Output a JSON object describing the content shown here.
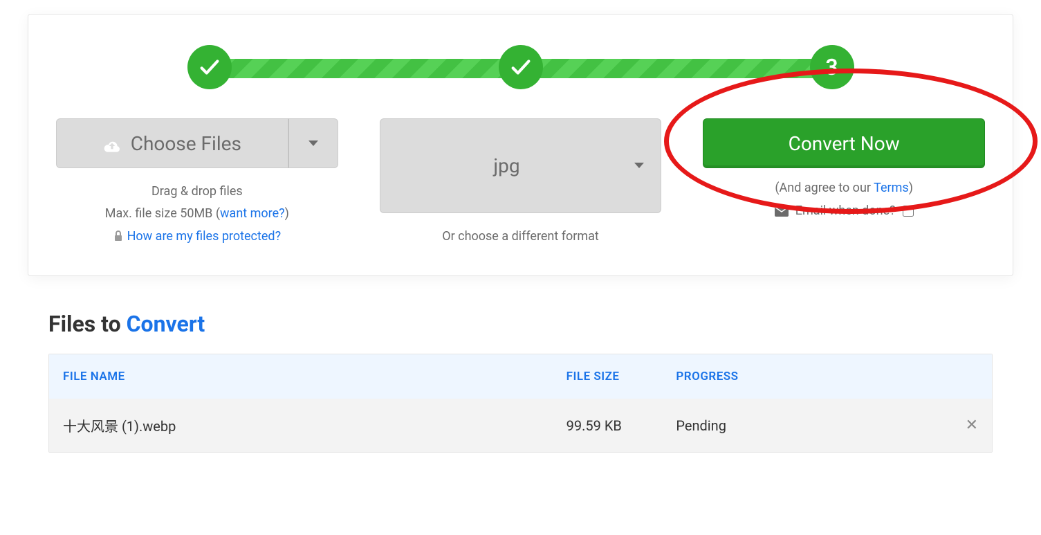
{
  "steps": {
    "step3_label": "3"
  },
  "choose": {
    "button_label": "Choose Files",
    "help_line1": "Drag & drop files",
    "help_line2_prefix": "Max. file size 50MB (",
    "help_line2_link": "want more?",
    "help_line2_suffix": ")",
    "help_line3_link": "How are my files protected?"
  },
  "format": {
    "selected": "jpg",
    "help": "Or choose a different format"
  },
  "convert": {
    "button_label": "Convert Now",
    "agree_prefix": "(And agree to our ",
    "agree_link": "Terms",
    "agree_suffix": ")",
    "email_label": "Email when done?"
  },
  "files_section": {
    "heading_plain": "Files to ",
    "heading_accent": "Convert",
    "columns": {
      "name": "FILE NAME",
      "size": "FILE SIZE",
      "progress": "PROGRESS"
    },
    "rows": [
      {
        "name": "十大风景 (1).webp",
        "size": "99.59 KB",
        "progress": "Pending"
      }
    ]
  }
}
